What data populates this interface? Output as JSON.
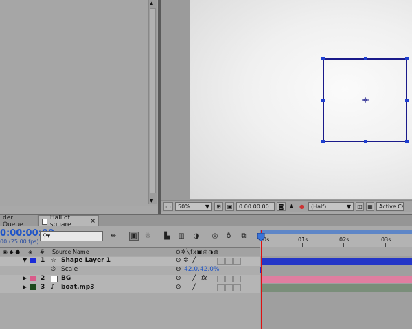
{
  "viewer": {
    "zoom": "50%",
    "time": "0:00:00:00",
    "resolution": "(Half)",
    "camera": "Active Ca"
  },
  "tabs": {
    "render_queue": "der Queue",
    "composition": "Hall of square",
    "close": "×"
  },
  "timeline": {
    "timecode": "0:00:00:00",
    "fps": "00 (25.00 fps)",
    "search_placeholder": "",
    "ruler": [
      "0s",
      "01s",
      "02s",
      "03s"
    ],
    "headers": {
      "num": "#",
      "source_name": "Source Name"
    }
  },
  "layers": [
    {
      "num": "1",
      "name": "Shape Layer 1",
      "color": "#1a2bd8",
      "bar_color": "#2436c8",
      "type": "shape",
      "expanded": true
    },
    {
      "num": "2",
      "name": "BG",
      "color": "#d95b8a",
      "bar_color": "#e07ea0",
      "type": "solid",
      "expanded": false
    },
    {
      "num": "3",
      "name": "boat.mp3",
      "color": "#1d4a1d",
      "bar_color": "#7a8e7a",
      "type": "audio",
      "expanded": false
    }
  ],
  "property": {
    "name": "Scale",
    "value": "42,0,42,0%"
  },
  "colors": {
    "accent": "#1f55c8",
    "playhead": "#dd1111",
    "shape_stroke": "#1a1a8a"
  }
}
